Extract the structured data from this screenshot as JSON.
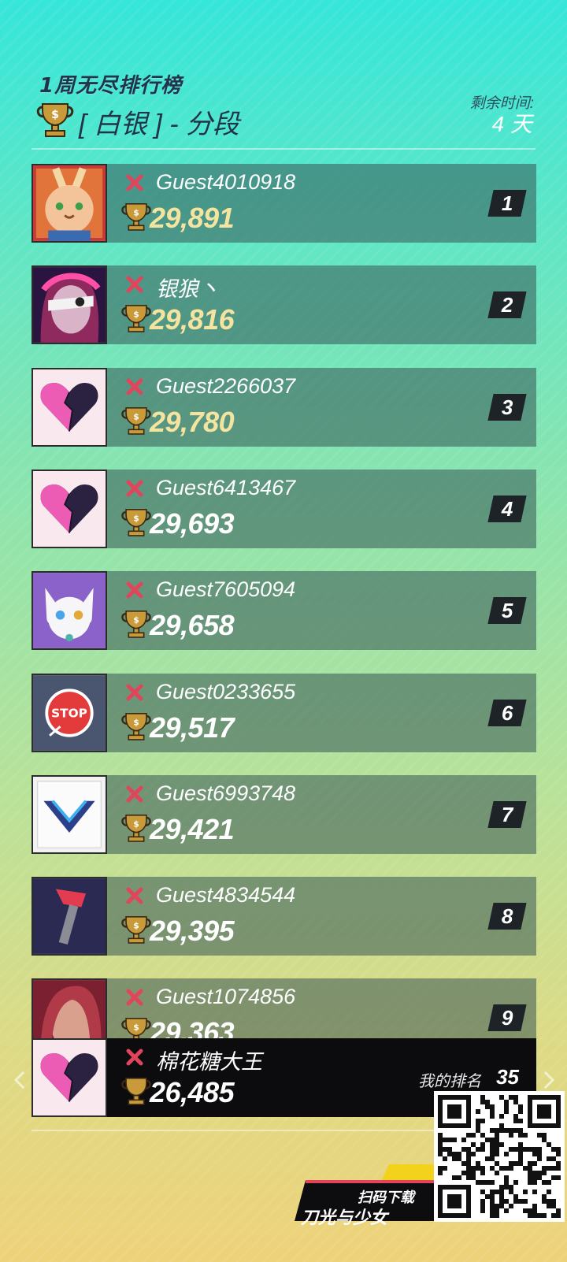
{
  "header": {
    "title": "1周无尽排行榜",
    "subtitle": "[ 白银 ] - 分段",
    "remaining_label": "剩余时间:",
    "remaining_value": "4 天"
  },
  "leaderboard": [
    {
      "rank": "1",
      "name": "Guest4010918",
      "score": "29,891",
      "avatar": "rabbit-avatar",
      "score_color": "gold"
    },
    {
      "rank": "2",
      "name": "银狼丶",
      "score": "29,816",
      "avatar": "masked-girl-avatar",
      "score_color": "gold"
    },
    {
      "rank": "3",
      "name": "Guest2266037",
      "score": "29,780",
      "avatar": "broken-heart-avatar",
      "score_color": "gold"
    },
    {
      "rank": "4",
      "name": "Guest6413467",
      "score": "29,693",
      "avatar": "broken-heart-avatar",
      "score_color": "white"
    },
    {
      "rank": "5",
      "name": "Guest7605094",
      "score": "29,658",
      "avatar": "white-cat-avatar",
      "score_color": "white"
    },
    {
      "rank": "6",
      "name": "Guest0233655",
      "score": "29,517",
      "avatar": "stop-sign-avatar",
      "score_color": "white"
    },
    {
      "rank": "7",
      "name": "Guest6993748",
      "score": "29,421",
      "avatar": "blue-chevron-avatar",
      "score_color": "white"
    },
    {
      "rank": "8",
      "name": "Guest4834544",
      "score": "29,395",
      "avatar": "red-hammer-avatar",
      "score_color": "white"
    },
    {
      "rank": "9",
      "name": "Guest1074856",
      "score": "29,363",
      "avatar": "red-hair-avatar",
      "score_color": "white"
    }
  ],
  "my_entry": {
    "name": "棉花糖大王",
    "score": "26,485",
    "rank_label": "我的排名",
    "rank_value": "35",
    "avatar": "broken-heart-avatar"
  },
  "promo": {
    "scan_label": "扫码下载",
    "game_name": "刀光与少女"
  },
  "colors": {
    "accent_red": "#e0455c",
    "trophy_gold": "#c99a3a",
    "my_row_bg": "#0c0c0e"
  }
}
